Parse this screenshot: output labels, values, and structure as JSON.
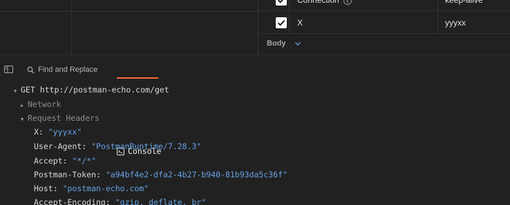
{
  "headers_table": {
    "rows": [
      {
        "enabled": true,
        "key": "Connection",
        "value": "keep-alive",
        "has_info_icon": true
      },
      {
        "enabled": true,
        "key": "X",
        "value": "yyyxx",
        "has_info_icon": false
      }
    ]
  },
  "body_section": {
    "label": "Body"
  },
  "pane_tabs": {
    "find_replace": "Find and Replace",
    "console": "Console",
    "active": "console"
  },
  "console": {
    "request_line": "GET http://postman-echo.com/get",
    "network_label": "Network",
    "request_headers_label": "Request Headers",
    "headers": [
      {
        "key": "X:",
        "value": "\"yyyxx\""
      },
      {
        "key": "User-Agent:",
        "value": "\"PostmanRuntime/7.28.3\""
      },
      {
        "key": "Accept:",
        "value": "\"*/*\""
      },
      {
        "key": "Postman-Token:",
        "value": "\"a94bf4e2-dfa2-4b27-b940-81b93da5c36f\""
      },
      {
        "key": "Host:",
        "value": "\"postman-echo.com\""
      },
      {
        "key": "Accept-Encoding:",
        "value": "\"gzip, deflate, br\""
      }
    ]
  },
  "colors": {
    "background": "#212121",
    "accent": "#ff6c37",
    "value_blue": "#66a3e6"
  },
  "icons": {
    "pane_toggle": "sidebar-panel-icon",
    "find": "search-icon",
    "console": "terminal-icon",
    "body": "chevron-down-icon"
  }
}
